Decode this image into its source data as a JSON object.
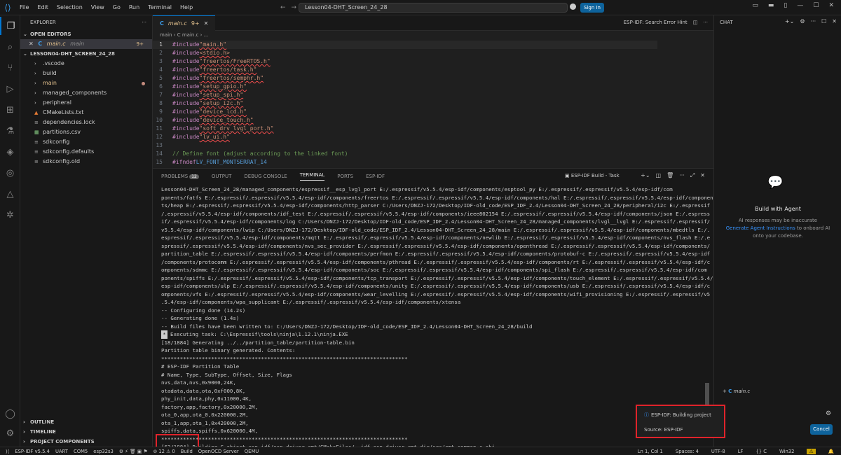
{
  "titlebar": {
    "menu": [
      "File",
      "Edit",
      "Selection",
      "View",
      "Go",
      "Run",
      "Terminal",
      "Help"
    ],
    "search": "Lesson04-DHT_Screen_24_28",
    "sign_in": "Sign In"
  },
  "sidebar": {
    "header": "EXPLORER",
    "open_editors_label": "OPEN EDITORS",
    "open_editor": {
      "name": "main.c",
      "folder": "main",
      "badge": "9+"
    },
    "project": "LESSON04-DHT_SCREEN_24_28",
    "tree": [
      {
        "name": ".vscode",
        "type": "folder"
      },
      {
        "name": "build",
        "type": "folder"
      },
      {
        "name": "main",
        "type": "folder"
      },
      {
        "name": "managed_components",
        "type": "folder"
      },
      {
        "name": "peripheral",
        "type": "folder"
      },
      {
        "name": "CMakeLists.txt",
        "type": "file"
      },
      {
        "name": "dependencies.lock",
        "type": "file"
      },
      {
        "name": "partitions.csv",
        "type": "file"
      },
      {
        "name": "sdkconfig",
        "type": "file"
      },
      {
        "name": "sdkconfig.defaults",
        "type": "file"
      },
      {
        "name": "sdkconfig.old",
        "type": "file"
      }
    ],
    "bottom": [
      "OUTLINE",
      "TIMELINE",
      "PROJECT COMPONENTS"
    ]
  },
  "editor": {
    "tab": {
      "name": "main.c",
      "badge": "9+"
    },
    "error_hint": "ESP-IDF: Search Error Hint",
    "breadcrumb": "main  ›  C  main.c  ›  ...",
    "lines": [
      {
        "n": "1",
        "k": "#include",
        "s": "\"main.h\""
      },
      {
        "n": "2",
        "k": "#include",
        "s": "<stdio.h>"
      },
      {
        "n": "3",
        "k": "#include",
        "s": "\"freertos/FreeRTOS.h\""
      },
      {
        "n": "4",
        "k": "#include",
        "s": "\"freertos/task.h\""
      },
      {
        "n": "5",
        "k": "#include",
        "s": "\"freertos/semphr.h\""
      },
      {
        "n": "6",
        "k": "#include",
        "s": "\"setup_gpio.h\""
      },
      {
        "n": "7",
        "k": "#include",
        "s": "\"setup_spi.h\""
      },
      {
        "n": "8",
        "k": "#include",
        "s": "\"setup_i2c.h\""
      },
      {
        "n": "9",
        "k": "#include",
        "s": "\"device_lcd.h\""
      },
      {
        "n": "10",
        "k": "#include",
        "s": "\"device_touch.h\""
      },
      {
        "n": "11",
        "k": "#include",
        "s": "\"soft_drv_lvgl_port.h\""
      },
      {
        "n": "12",
        "k": "#include",
        "s": "\"lv_ui.h\""
      },
      {
        "n": "13",
        "k": "",
        "s": ""
      },
      {
        "n": "14",
        "k": "",
        "s": "",
        "c": "// Define font (adjust according to the linked font)"
      },
      {
        "n": "15",
        "k": "#ifndef",
        "s": "",
        "m": "LV_FONT_MONTSERRAT_14"
      }
    ]
  },
  "panel": {
    "tabs": [
      "PROBLEMS",
      "OUTPUT",
      "DEBUG CONSOLE",
      "TERMINAL",
      "PORTS",
      "ESP-IDF"
    ],
    "problems_count": "12",
    "task": "ESP-IDF Build - Task",
    "terminal_lines": [
      "Lesson04-DHT_Screen_24_28/managed_components/espressif__esp_lvgl_port E:/.espressif/v5.5.4/esp-idf/components/esptool_py E:/.espressif/.espressif/v5.5.4/esp-idf/com",
      "ponents/fatfs E:/.espressif/.espressif/v5.5.4/esp-idf/components/freertos E:/.espressif/.espressif/v5.5.4/esp-idf/components/hal E:/.espressif/.espressif/v5.5.4/esp-idf/componen",
      "ts/heap E:/.espressif/.espressif/v5.5.4/esp-idf/components/http_parser C:/Users/DNZJ-172/Desktop/IDF-old_code/ESP_IDF_2.4/Lesson04-DHT_Screen_24_28/peripheral/i2c E:/.espressif",
      "/.espressif/v5.5.4/esp-idf/components/idf_test E:/.espressif/.espressif/v5.5.4/esp-idf/components/ieee802154 E:/.espressif/.espressif/v5.5.4/esp-idf/components/json E:/.espress",
      "if/.espressif/v5.5.4/esp-idf/components/log C:/Users/DNZJ-172/Desktop/IDF-old_code/ESP_IDF_2.4/Lesson04-DHT_Screen_24_28/managed_components/lvgl__lvgl E:/.espressif/.espressif/",
      "v5.5.4/esp-idf/components/lwip C:/Users/DNZJ-172/Desktop/IDF-old_code/ESP_IDF_2.4/Lesson04-DHT_Screen_24_28/main E:/.espressif/.espressif/v5.5.4/esp-idf/components/mbedtls E:/.",
      "espressif/.espressif/v5.5.4/esp-idf/components/mqtt E:/.espressif/.espressif/v5.5.4/esp-idf/components/newlib E:/.espressif/.espressif/v5.5.4/esp-idf/components/nvs_flash E:/.e",
      "spressif/.espressif/v5.5.4/esp-idf/components/nvs_sec_provider E:/.espressif/.espressif/v5.5.4/esp-idf/components/openthread E:/.espressif/.espressif/v5.5.4/esp-idf/components/",
      "partition_table E:/.espressif/.espressif/v5.5.4/esp-idf/components/perfmon E:/.espressif/.espressif/v5.5.4/esp-idf/components/protobuf-c E:/.espressif/.espressif/v5.5.4/esp-idf",
      "/components/protocomm E:/.espressif/.espressif/v5.5.4/esp-idf/components/pthread E:/.espressif/.espressif/v5.5.4/esp-idf/components/rt E:/.espressif/.espressif/v5.5.4/esp-idf/c",
      "omponents/sdmmc E:/.espressif/.espressif/v5.5.4/esp-idf/components/soc E:/.espressif/.espressif/v5.5.4/esp-idf/components/spi_flash E:/.espressif/.espressif/v5.5.4/esp-idf/com",
      "ponents/spiffs E:/.espressif/.espressif/v5.5.4/esp-idf/components/tcp_transport E:/.espressif/.espressif/v5.5.4/esp-idf/components/touch_element E:/.espressif/.espressif/v5.5.4/",
      "esp-idf/components/ulp E:/.espressif/.espressif/v5.5.4/esp-idf/components/unity E:/.espressif/.espressif/v5.5.4/esp-idf/components/usb E:/.espressif/.espressif/v5.5.4/esp-idf/c",
      "omponents/vfs E:/.espressif/.espressif/v5.5.4/esp-idf/components/wear_levelling E:/.espressif/.espressif/v5.5.4/esp-idf/components/wifi_provisioning E:/.espressif/.espressif/v5",
      ".5.4/esp-idf/components/wpa_supplicant E:/.espressif/.espressif/v5.5.4/esp-idf/components/xtensa",
      "-- Configuring done (14.2s)",
      "-- Generating done (1.4s)",
      "-- Build files have been written to: C:/Users/DNZJ-172/Desktop/IDF-old_code/ESP_IDF_2.4/Lesson04-DHT_Screen_24_28/build",
      ""
    ],
    "exec_line": "Executing task: C:\\Espressif\\tools\\ninja\\1.12.1\\ninja.EXE",
    "terminal_lines2": [
      "",
      "[18/1884] Generating ../../partition_table/partition-table.bin",
      "Partition table binary generated. Contents:",
      "*******************************************************************************",
      "# ESP-IDF Partition Table",
      "# Name, Type, SubType, Offset, Size, Flags",
      "nvs,data,nvs,0x9000,24K,",
      "otadata,data,ota,0xf000,8K,",
      "phy_init,data,phy,0x11000,4K,",
      "factory,app,factory,0x20000,2M,",
      "ota_0,app,ota_0,0x220000,2M,",
      "ota_1,app,ota_1,0x420000,2M,",
      "spiffs,data,spiffs,0x620000,4M,",
      "*******************************************************************************",
      "[63/1884] Building C object esp-idf/esp_driver_rmt/CMakeFiles/__idf_esp_driver_rmt.dir/src/rmt_common.c.obj"
    ]
  },
  "chat": {
    "title": "CHAT",
    "agent_title": "Build with Agent",
    "agent_desc_1": "AI responses may be inaccurate",
    "agent_link": "Generate Agent Instructions",
    "agent_desc_2": "to onboard AI onto your codebase.",
    "context_file": "main.c"
  },
  "notification": {
    "title": "ESP-IDF: Building project",
    "source": "Source: ESP-IDF",
    "cancel": "Cancel"
  },
  "statusbar": {
    "left": [
      "ESP-IDF v5.5.4",
      "UART",
      "COM5",
      "esp32s3",
      "⊘ 12 ⚠ 0",
      "Build",
      "OpenOCD Server",
      "QEMU"
    ],
    "right": [
      "Ln 1, Col 1",
      "Spaces: 4",
      "UTF-8",
      "LF",
      "{} C",
      "Win32"
    ]
  },
  "colors": {
    "accent": "#0078d4",
    "error_red": "#e0232b",
    "string": "#ce9178",
    "keyword": "#c586c0"
  }
}
